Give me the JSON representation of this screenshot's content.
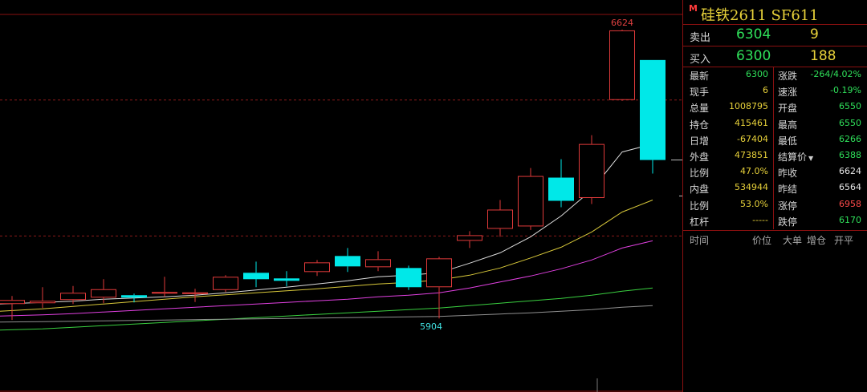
{
  "panel": {
    "marker": "M",
    "title": "硅铁2611  SF611",
    "ask": {
      "label": "卖出",
      "price": "6304",
      "volume": "9"
    },
    "bid": {
      "label": "买入",
      "price": "6300",
      "volume": "188"
    },
    "left_stats": [
      {
        "label": "最新",
        "value": "6300",
        "color": "green"
      },
      {
        "label": "现手",
        "value": "6",
        "color": "yellow"
      },
      {
        "label": "总量",
        "value": "1008795",
        "color": "yellow"
      },
      {
        "label": "持仓",
        "value": "415461",
        "color": "yellow"
      },
      {
        "label": "日增",
        "value": "-67404",
        "color": "yellow"
      },
      {
        "label": "外盘",
        "value": "473851",
        "color": "yellow"
      },
      {
        "label": "比例",
        "value": "47.0%",
        "color": "yellow"
      },
      {
        "label": "内盘",
        "value": "534944",
        "color": "yellow"
      },
      {
        "label": "比例",
        "value": "53.0%",
        "color": "yellow"
      },
      {
        "label": "杠杆",
        "value": "-----",
        "color": "yellow"
      }
    ],
    "right_stats": [
      {
        "label": "涨跌",
        "value": "-264/4.02%",
        "color": "green"
      },
      {
        "label": "速涨",
        "value": "-0.19%",
        "color": "green"
      },
      {
        "label": "开盘",
        "value": "6550",
        "color": "green"
      },
      {
        "label": "最高",
        "value": "6550",
        "color": "green"
      },
      {
        "label": "最低",
        "value": "6266",
        "color": "green"
      },
      {
        "label": "结算价",
        "value": "6388",
        "color": "green",
        "dropdown": true
      },
      {
        "label": "昨收",
        "value": "6624",
        "color": "white"
      },
      {
        "label": "昨结",
        "value": "6564",
        "color": "white"
      },
      {
        "label": "涨停",
        "value": "6958",
        "color": "red"
      },
      {
        "label": "跌停",
        "value": "6170",
        "color": "green"
      }
    ],
    "tick_headers": [
      "时间",
      "价位",
      "大单",
      "增仓",
      "开平"
    ]
  },
  "chart_data": {
    "type": "candlestick",
    "high_label": "6624",
    "low_label": "5904",
    "ylim": [
      5720,
      6700
    ],
    "reference_lines": [
      6450,
      6110
    ],
    "candles": [
      {
        "o": 5940,
        "c": 5950,
        "h": 5960,
        "l": 5900
      },
      {
        "o": 5942,
        "c": 5948,
        "h": 5982,
        "l": 5930
      },
      {
        "o": 5950,
        "c": 5968,
        "h": 5985,
        "l": 5940
      },
      {
        "o": 5956,
        "c": 5977,
        "h": 6002,
        "l": 5942
      },
      {
        "o": 5962,
        "c": 5956,
        "h": 5966,
        "l": 5944
      },
      {
        "o": 5966,
        "c": 5970,
        "h": 6008,
        "l": 5958
      },
      {
        "o": 5965,
        "c": 5969,
        "h": 5978,
        "l": 5945
      },
      {
        "o": 5975,
        "c": 6008,
        "h": 6012,
        "l": 5970
      },
      {
        "o": 6018,
        "c": 6002,
        "h": 6046,
        "l": 5982
      },
      {
        "o": 6004,
        "c": 5998,
        "h": 6022,
        "l": 5984
      },
      {
        "o": 6020,
        "c": 6044,
        "h": 6050,
        "l": 6010
      },
      {
        "o": 6060,
        "c": 6034,
        "h": 6080,
        "l": 6020
      },
      {
        "o": 6032,
        "c": 6052,
        "h": 6072,
        "l": 6022
      },
      {
        "o": 6030,
        "c": 5982,
        "h": 6036,
        "l": 5975
      },
      {
        "o": 5982,
        "c": 6054,
        "h": 6058,
        "l": 5904
      },
      {
        "o": 6098,
        "c": 6112,
        "h": 6122,
        "l": 6080
      },
      {
        "o": 6128,
        "c": 6176,
        "h": 6200,
        "l": 6108
      },
      {
        "o": 6134,
        "c": 6260,
        "h": 6280,
        "l": 6125
      },
      {
        "o": 6256,
        "c": 6198,
        "h": 6302,
        "l": 6182
      },
      {
        "o": 6205,
        "c": 6340,
        "h": 6362,
        "l": 6190
      },
      {
        "o": 6450,
        "c": 6624,
        "h": 6626,
        "l": 6448
      },
      {
        "o": 6550,
        "c": 6300,
        "h": 6550,
        "l": 6266
      }
    ],
    "ma_lines": [
      {
        "color": "#dcdcdc",
        "values": [
          5940,
          5944,
          5947,
          5952,
          5955,
          5958,
          5962,
          5968,
          5975,
          5982,
          5990,
          5998,
          6008,
          6012,
          6018,
          6042,
          6068,
          6108,
          6160,
          6225,
          6320,
          6340
        ]
      },
      {
        "color": "#d8c83a",
        "values": [
          5922,
          5928,
          5934,
          5940,
          5946,
          5952,
          5958,
          5963,
          5968,
          5973,
          5978,
          5984,
          5990,
          5994,
          6000,
          6012,
          6030,
          6055,
          6082,
          6120,
          6170,
          6200
        ]
      },
      {
        "color": "#e040e0",
        "values": [
          5910,
          5913,
          5916,
          5920,
          5924,
          5928,
          5932,
          5936,
          5940,
          5944,
          5948,
          5952,
          5958,
          5962,
          5968,
          5980,
          5995,
          6010,
          6028,
          6050,
          6080,
          6098
        ]
      },
      {
        "color": "#3ad040",
        "values": [
          5875,
          5878,
          5882,
          5886,
          5890,
          5894,
          5898,
          5902,
          5906,
          5910,
          5914,
          5918,
          5922,
          5926,
          5930,
          5936,
          5942,
          5948,
          5954,
          5962,
          5972,
          5980
        ]
      },
      {
        "color": "#909090",
        "values": [
          5895,
          5896,
          5897,
          5898,
          5899,
          5900,
          5901,
          5902,
          5903,
          5904,
          5905,
          5906,
          5907,
          5908,
          5909,
          5912,
          5915,
          5918,
          5922,
          5926,
          5932,
          5936
        ]
      }
    ]
  }
}
